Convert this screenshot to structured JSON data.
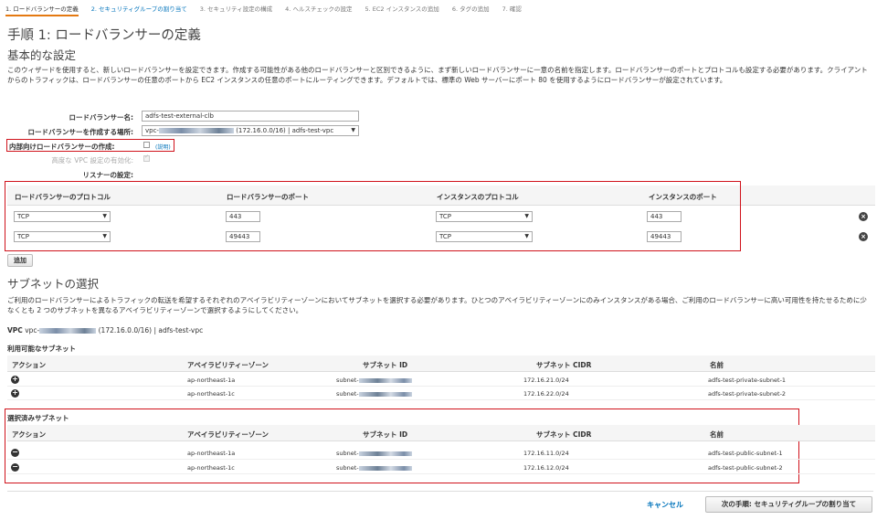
{
  "wizard_steps": [
    {
      "label": "1. ロードバランサーの定義"
    },
    {
      "label": "2. セキュリティグループの割り当て"
    },
    {
      "label": "3. セキュリティ設定の構成"
    },
    {
      "label": "4. ヘルスチェックの設定"
    },
    {
      "label": "5. EC2 インスタンスの追加"
    },
    {
      "label": "6. タグの追加"
    },
    {
      "label": "7. 確認"
    }
  ],
  "page_title": "手順 1: ロードバランサーの定義",
  "basic": {
    "heading": "基本的な設定",
    "description": "このウィザードを使用すると、新しいロードバランサーを設定できます。作成する可能性がある他のロードバランサーと区別できるように、まず新しいロードバランサーに一意の名前を指定します。ロードバランサーのポートとプロトコルも設定する必要があります。クライアントからのトラフィックは、ロードバランサーの任意のポートから EC2 インスタンスの任意のポートにルーティングできます。デフォルトでは、標準の Web サーバーにポート 80 を使用するようにロードバランサーが設定されています。",
    "name_label": "ロードバランサー名:",
    "name_value": "adfs-test-external-clb",
    "location_label": "ロードバランサーを作成する場所:",
    "location_prefix": "vpc-",
    "location_suffix": "(172.16.0.0/16) | adfs-test-vpc",
    "internal_label": "内部向けロードバランサーの作成:",
    "internal_help": "(説明)",
    "advanced_vpc_label": "高度な VPC 設定の有効化:",
    "listener_label": "リスナーの設定:"
  },
  "listeners": {
    "headers": [
      "ロードバランサーのプロトコル",
      "ロードバランサーのポート",
      "インスタンスのプロトコル",
      "インスタンスのポート"
    ],
    "rows": [
      {
        "lb_protocol": "TCP",
        "lb_port": "443",
        "instance_protocol": "TCP",
        "instance_port": "443"
      },
      {
        "lb_protocol": "TCP",
        "lb_port": "49443",
        "instance_protocol": "TCP",
        "instance_port": "49443"
      }
    ],
    "add_button": "追加"
  },
  "subnets": {
    "heading": "サブネットの選択",
    "description": "ご利用のロードバランサーによるトラフィックの転送を希望するそれぞれのアベイラビリティーゾーンにおいてサブネットを選択する必要があります。ひとつのアベイラビリティーゾーンにのみインスタンスがある場合、ご利用のロードバランサーに高い可用性を持たせるために少なくとも 2 つのサブネットを異なるアベイラビリティーゾーンで選択するようにしてください。",
    "vpc_label": "VPC",
    "vpc_prefix": "vpc-",
    "vpc_suffix": "(172.16.0.0/16) | adfs-test-vpc",
    "available_title": "利用可能なサブネット",
    "selected_title": "選択済みサブネット",
    "columns": [
      "アクション",
      "アベイラビリティーゾーン",
      "サブネット ID",
      "サブネット CIDR",
      "名前"
    ],
    "subnet_id_prefix": "subnet-",
    "available": [
      {
        "az": "ap-northeast-1a",
        "cidr": "172.16.21.0/24",
        "name": "adfs-test-private-subnet-1"
      },
      {
        "az": "ap-northeast-1c",
        "cidr": "172.16.22.0/24",
        "name": "adfs-test-private-subnet-2"
      }
    ],
    "selected": [
      {
        "az": "ap-northeast-1a",
        "cidr": "172.16.11.0/24",
        "name": "adfs-test-public-subnet-1"
      },
      {
        "az": "ap-northeast-1c",
        "cidr": "172.16.12.0/24",
        "name": "adfs-test-public-subnet-2"
      }
    ]
  },
  "footer": {
    "cancel": "キャンセル",
    "next": "次の手順: セキュリティグループの割り当て"
  },
  "colors": {
    "accent": "#e47911",
    "link": "#0073bb",
    "highlight": "#d0121b"
  },
  "icons": {
    "add": "plus-circle-icon",
    "remove": "minus-circle-icon",
    "delete": "close-circle-icon"
  }
}
